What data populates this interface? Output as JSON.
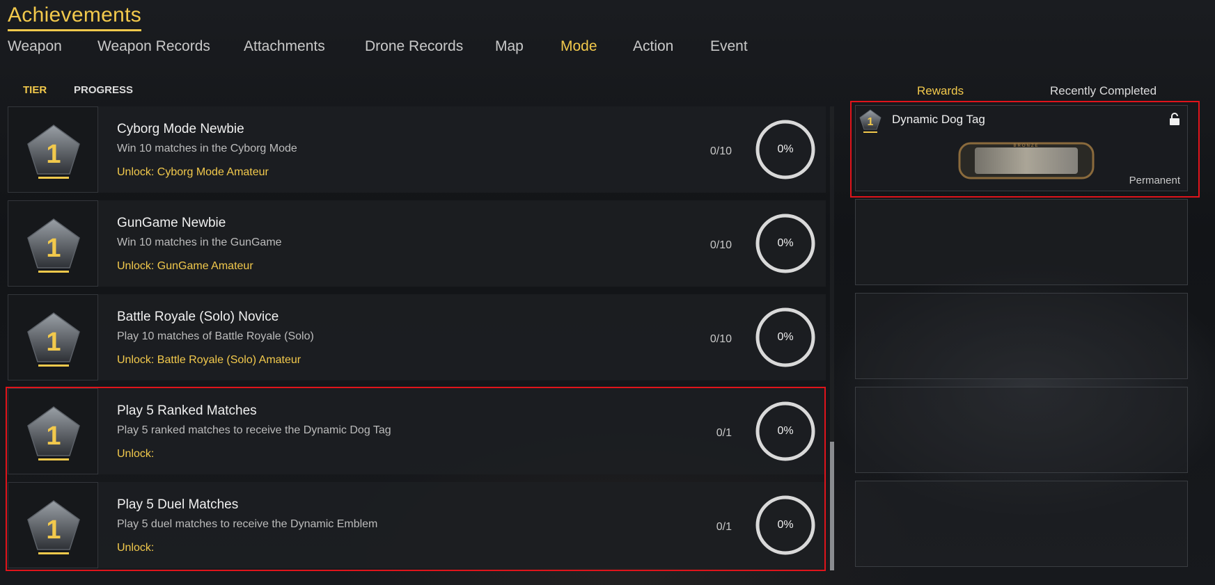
{
  "header": {
    "title": "Achievements"
  },
  "tabs": [
    {
      "label": "Weapon"
    },
    {
      "label": "Weapon Records"
    },
    {
      "label": "Attachments"
    },
    {
      "label": "Drone Records"
    },
    {
      "label": "Map"
    },
    {
      "label": "Mode"
    },
    {
      "label": "Action"
    },
    {
      "label": "Event"
    }
  ],
  "active_tab": "Mode",
  "subtabs": [
    {
      "label": "TIER"
    },
    {
      "label": "PROGRESS"
    }
  ],
  "achievements": [
    {
      "tier": "1",
      "title": "Cyborg Mode Newbie",
      "description": "Win 10 matches in the Cyborg Mode",
      "unlock": "Unlock: Cyborg Mode Amateur",
      "count": "0/10",
      "percent": "0%",
      "progress": 0
    },
    {
      "tier": "1",
      "title": "GunGame Newbie",
      "description": "Win 10 matches in the GunGame",
      "unlock": "Unlock: GunGame Amateur",
      "count": "0/10",
      "percent": "0%",
      "progress": 0
    },
    {
      "tier": "1",
      "title": "Battle Royale (Solo) Novice",
      "description": "Play 10 matches of Battle Royale (Solo)",
      "unlock": "Unlock: Battle Royale (Solo) Amateur",
      "count": "0/10",
      "percent": "0%",
      "progress": 0
    },
    {
      "tier": "1",
      "title": "Play 5 Ranked Matches",
      "description": "Play 5 ranked matches to receive the Dynamic Dog Tag",
      "unlock": "Unlock:",
      "count": "0/1",
      "percent": "0%",
      "progress": 0
    },
    {
      "tier": "1",
      "title": "Play 5 Duel Matches",
      "description": "Play 5 duel matches to receive the Dynamic Emblem",
      "unlock": "Unlock:",
      "count": "0/1",
      "percent": "0%",
      "progress": 0
    }
  ],
  "rewards_panel": {
    "tabs": [
      {
        "label": "Rewards"
      },
      {
        "label": "Recently Completed"
      }
    ],
    "active_tab": "Rewards",
    "items": [
      {
        "tier": "1",
        "name": "Dynamic Dog Tag",
        "duration": "Permanent",
        "tag_text": "BRONZE",
        "locked": true
      }
    ],
    "empty_slots": 4
  },
  "colors": {
    "accent": "#f2c94c",
    "highlight": "#e0141b",
    "ring": "#d9d9d9"
  },
  "icons": [
    "tier-badge-icon",
    "lock-icon",
    "dog-tag-icon",
    "progress-ring-icon"
  ]
}
